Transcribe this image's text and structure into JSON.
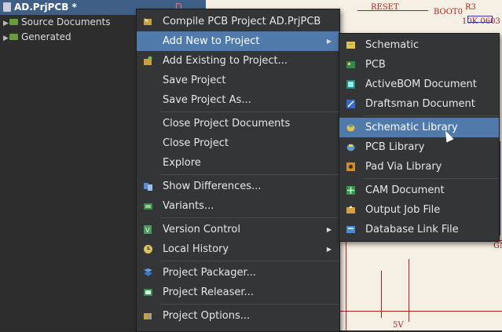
{
  "project": {
    "title": "AD.PrjPCB *",
    "dirty_mark": "D",
    "items": [
      {
        "label": "Source Documents"
      },
      {
        "label": "Generated"
      }
    ]
  },
  "schematic": {
    "labels": [
      "RESET",
      "BOOT0",
      "R3",
      "10K 0603",
      "5V",
      "GN"
    ]
  },
  "main_menu": [
    {
      "label": "Compile PCB Project AD.PrjPCB",
      "icon": "compile-icon"
    },
    {
      "label": "Add New to Project",
      "submenu": true,
      "highlighted": true
    },
    {
      "label": "Add Existing to Project...",
      "icon": "add-existing-icon"
    },
    {
      "label": "Save Project"
    },
    {
      "label": "Save Project As..."
    },
    {
      "label": "Close Project Documents"
    },
    {
      "label": "Close Project"
    },
    {
      "label": "Explore"
    },
    {
      "label": "Show Differences...",
      "icon": "differences-icon"
    },
    {
      "label": "Variants...",
      "icon": "variants-icon"
    },
    {
      "label": "Version Control",
      "icon": "version-control-icon",
      "submenu": true
    },
    {
      "label": "Local History",
      "icon": "history-icon",
      "submenu": true
    },
    {
      "label": "Project Packager...",
      "icon": "packager-icon"
    },
    {
      "label": "Project Releaser...",
      "icon": "releaser-icon"
    },
    {
      "label": "Project Options...",
      "icon": "options-icon"
    }
  ],
  "sub_menu": [
    {
      "label": "Schematic",
      "icon": "schematic-icon"
    },
    {
      "label": "PCB",
      "icon": "pcb-icon"
    },
    {
      "label": "ActiveBOM Document",
      "icon": "bom-icon"
    },
    {
      "label": "Draftsman Document",
      "icon": "draftsman-icon"
    },
    {
      "label": "Schematic Library",
      "icon": "schlib-icon",
      "highlighted": true
    },
    {
      "label": "PCB Library",
      "icon": "pcblib-icon"
    },
    {
      "label": "Pad Via Library",
      "icon": "padvia-icon"
    },
    {
      "label": "CAM Document",
      "icon": "cam-icon"
    },
    {
      "label": "Output Job File",
      "icon": "outjob-icon"
    },
    {
      "label": "Database Link File",
      "icon": "dblink-icon"
    }
  ],
  "colors": {
    "menu_bg": "#333537",
    "highlight": "#4f7aaa",
    "project_title_bg": "#3f5f86",
    "schematic_bg": "#f6f0e4"
  }
}
